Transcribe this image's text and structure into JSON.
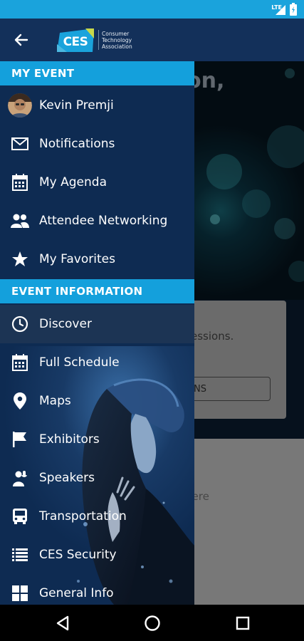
{
  "status_bar": {
    "network": "LTE"
  },
  "header": {
    "back_icon": "arrow-left-icon",
    "logo_text": "CES",
    "logo_org": "Consumer Technology Association"
  },
  "background": {
    "greeting_fragment": "on,",
    "card_text": "essions.",
    "card_button_fragment": "NS",
    "lower_text": "here"
  },
  "drawer": {
    "my_event": {
      "title": "MY EVENT",
      "items": [
        {
          "label": "Kevin Premji",
          "icon": "avatar"
        },
        {
          "label": "Notifications",
          "icon": "envelope-icon"
        },
        {
          "label": "My Agenda",
          "icon": "calendar-icon"
        },
        {
          "label": "Attendee Networking",
          "icon": "people-icon"
        },
        {
          "label": "My Favorites",
          "icon": "star-icon"
        }
      ]
    },
    "event_information": {
      "title": "EVENT INFORMATION",
      "items": [
        {
          "label": "Discover",
          "icon": "clock-icon",
          "active": true
        },
        {
          "label": "Full Schedule",
          "icon": "calendar-icon"
        },
        {
          "label": "Maps",
          "icon": "map-pin-icon"
        },
        {
          "label": "Exhibitors",
          "icon": "flag-icon"
        },
        {
          "label": "Speakers",
          "icon": "speaker-icon"
        },
        {
          "label": "Transportation",
          "icon": "bus-icon"
        },
        {
          "label": "CES Security",
          "icon": "list-icon"
        },
        {
          "label": "General Info",
          "icon": "grid-icon"
        }
      ]
    }
  },
  "colors": {
    "accent": "#14a0dc",
    "drawer_bg": "#0e2b52",
    "header_bg": "#13305a",
    "status_bar": "#1aa3dc"
  },
  "nav_bar": {
    "back": "back-triangle-icon",
    "home": "home-circle-icon",
    "recents": "recents-square-icon"
  }
}
